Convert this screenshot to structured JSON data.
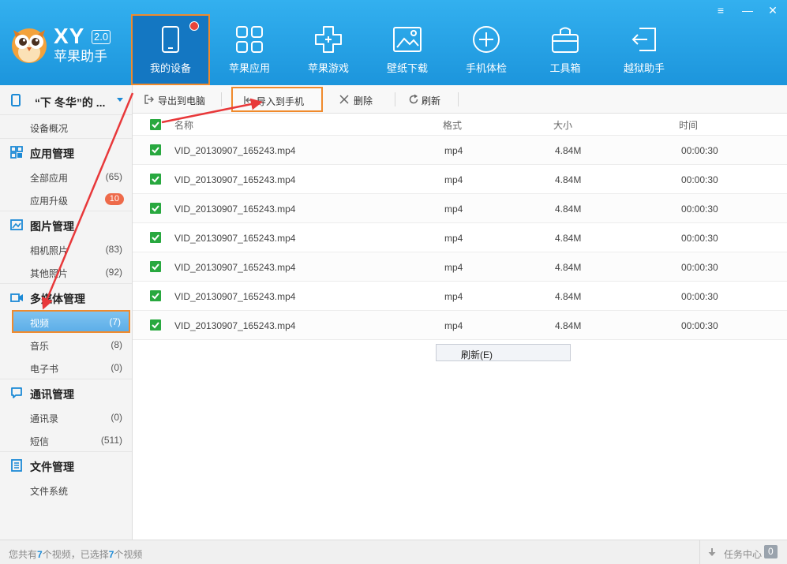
{
  "app": {
    "logo_text": "XY",
    "version": "2.0",
    "name": "苹果助手"
  },
  "nav": [
    {
      "label": "我的设备",
      "icon": "phone-icon",
      "active": true
    },
    {
      "label": "苹果应用",
      "icon": "apps-grid-icon"
    },
    {
      "label": "苹果游戏",
      "icon": "gamepad-icon"
    },
    {
      "label": "壁纸下载",
      "icon": "wallpaper-icon"
    },
    {
      "label": "手机体检",
      "icon": "plus-circle-icon"
    },
    {
      "label": "工具箱",
      "icon": "toolbox-icon"
    },
    {
      "label": "越狱助手",
      "icon": "jailbreak-icon"
    }
  ],
  "window": {
    "menu": "≡",
    "minimize": "—",
    "close": "✕"
  },
  "sidebar": {
    "device_name": "“下 冬华”的 ...",
    "device_overview": "设备概况",
    "sections": [
      {
        "title": "应用管理",
        "items": [
          {
            "label": "全部应用",
            "count": "(65)"
          },
          {
            "label": "应用升级",
            "badge": "10"
          }
        ]
      },
      {
        "title": "图片管理",
        "items": [
          {
            "label": "相机照片",
            "count": "(83)"
          },
          {
            "label": "其他照片",
            "count": "(92)"
          }
        ]
      },
      {
        "title": "多媒体管理",
        "items": [
          {
            "label": "视频",
            "count": "(7)"
          },
          {
            "label": "音乐",
            "count": "(8)"
          },
          {
            "label": "电子书",
            "count": "(0)"
          }
        ]
      },
      {
        "title": "通讯管理",
        "items": [
          {
            "label": "通讯录",
            "count": "(0)"
          },
          {
            "label": "短信",
            "count": "(511)"
          }
        ]
      },
      {
        "title": "文件管理",
        "items": [
          {
            "label": "文件系统",
            "count": ""
          }
        ]
      }
    ]
  },
  "toolbar": {
    "export": "导出到电脑",
    "import": "导入到手机",
    "delete": "删除",
    "refresh": "刷新"
  },
  "table": {
    "headers": {
      "name": "名称",
      "format": "格式",
      "size": "大小",
      "time": "时间"
    },
    "rows": [
      {
        "name": "VID_20130907_165243.mp4",
        "format": "mp4",
        "size": "4.84M",
        "time": "00:00:30"
      },
      {
        "name": "VID_20130907_165243.mp4",
        "format": "mp4",
        "size": "4.84M",
        "time": "00:00:30"
      },
      {
        "name": "VID_20130907_165243.mp4",
        "format": "mp4",
        "size": "4.84M",
        "time": "00:00:30"
      },
      {
        "name": "VID_20130907_165243.mp4",
        "format": "mp4",
        "size": "4.84M",
        "time": "00:00:30"
      },
      {
        "name": "VID_20130907_165243.mp4",
        "format": "mp4",
        "size": "4.84M",
        "time": "00:00:30"
      },
      {
        "name": "VID_20130907_165243.mp4",
        "format": "mp4",
        "size": "4.84M",
        "time": "00:00:30"
      },
      {
        "name": "VID_20130907_165243.mp4",
        "format": "mp4",
        "size": "4.84M",
        "time": "00:00:30"
      }
    ]
  },
  "context_menu": {
    "refresh": "刷新(E)"
  },
  "status": {
    "p1": "您共有",
    "total": "7",
    "p2": "个视频，已选择",
    "selected": "7",
    "p3": "个视频",
    "task_center": "任务中心",
    "task_count": "0"
  },
  "colors": {
    "header": "#1c95dc",
    "accent": "#1c8ad6",
    "highlight": "#f08a2c",
    "arrow": "#e8383a",
    "checkbox": "#28a83f"
  }
}
